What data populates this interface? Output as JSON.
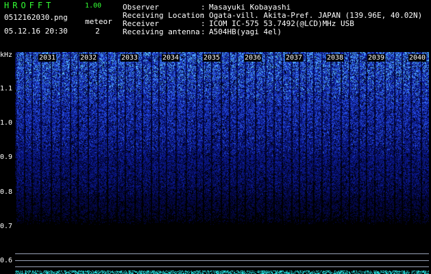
{
  "app": {
    "title": "HROFFT",
    "version": "1.00"
  },
  "header": {
    "filename": "0512162030.png",
    "datetime": "05.12.16 20:30",
    "meteor_label": "meteor",
    "meteor_count": "2"
  },
  "info": [
    {
      "key": "Observer",
      "sep": ":",
      "value": "Masayuki Kobayashi"
    },
    {
      "key": "Receiving Location",
      "sep": ":",
      "value": "Ogata-vill. Akita-Pref. JAPAN (139.96E, 40.02N)"
    },
    {
      "key": "Receiver",
      "sep": ":",
      "value": "ICOM IC-575 53.7492(@LCD)MHz USB"
    },
    {
      "key": "Receiving antenna",
      "sep": ":",
      "value": "A504HB(yagi 4el)"
    }
  ],
  "spectrogram": {
    "y_unit": "kHz",
    "y_ticks": [
      "1.1",
      "1.0",
      "0.9",
      "0.8",
      "0.7",
      "0.6"
    ],
    "time_ticks": [
      "2031",
      "2032",
      "2033",
      "2034",
      "2035",
      "2036",
      "2037",
      "2038",
      "2039",
      "2040"
    ],
    "colors": {
      "noise_high": "#4f7dff",
      "noise_low": "#101a66",
      "signal": "#40e0e0",
      "band": "#00008a"
    }
  }
}
